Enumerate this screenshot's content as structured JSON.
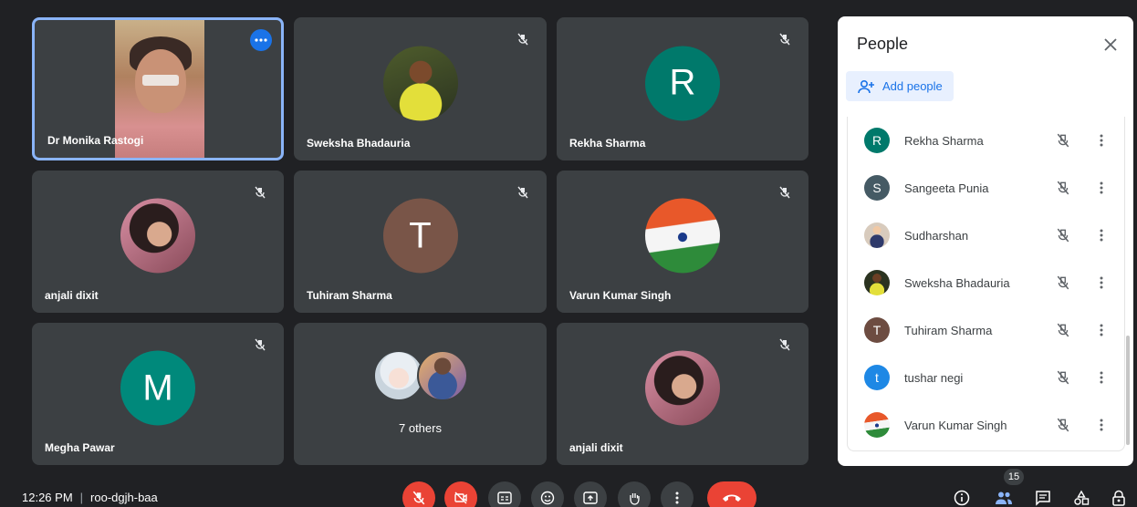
{
  "colors": {
    "tile_bg": "#3c4043",
    "page_bg": "#202124",
    "active_border": "#8ab4f8",
    "end_call": "#ea4335",
    "accent": "#1a73e8"
  },
  "tiles": [
    {
      "name": "Dr Monika Rastogi",
      "type": "video",
      "active": true
    },
    {
      "name": "Sweksha Bhadauria",
      "type": "photo"
    },
    {
      "name": "Rekha Sharma",
      "type": "letter",
      "letter": "R",
      "color": "#00796b"
    },
    {
      "name": "anjali dixit",
      "type": "photo"
    },
    {
      "name": "Tuhiram Sharma",
      "type": "letter",
      "letter": "T",
      "color": "#795548"
    },
    {
      "name": "Varun Kumar Singh",
      "type": "photo"
    },
    {
      "name": "Megha Pawar",
      "type": "letter",
      "letter": "M",
      "color": "#00897b"
    },
    {
      "name": "7 others",
      "type": "others"
    },
    {
      "name": "anjali dixit",
      "type": "photo"
    }
  ],
  "people_panel": {
    "title": "People",
    "add_label": "Add people",
    "participants": [
      {
        "name": "Rekha Sharma",
        "letter": "R",
        "color": "#00796b"
      },
      {
        "name": "Sangeeta Punia",
        "letter": "S",
        "color": "#455a64"
      },
      {
        "name": "Sudharshan",
        "letter": "",
        "color": "#5d4037"
      },
      {
        "name": "Sweksha Bhadauria",
        "letter": "",
        "color": "#33691e"
      },
      {
        "name": "Tuhiram Sharma",
        "letter": "T",
        "color": "#6d4c41"
      },
      {
        "name": "tushar negi",
        "letter": "t",
        "color": "#1e88e5"
      },
      {
        "name": "Varun Kumar Singh",
        "letter": "",
        "color": "#e65100"
      }
    ]
  },
  "bottom_bar": {
    "time": "12:26 PM",
    "meeting_code": "roo-dgjh-baa",
    "participant_count": "15"
  },
  "icons": {
    "tile_mute": "mic-off-icon",
    "more": "more-horiz-icon",
    "close": "close-icon",
    "add_person": "person-add-icon",
    "info": "info-icon",
    "people": "people-icon",
    "chat": "chat-icon",
    "activities": "activities-icon",
    "host_controls": "lock-person-icon"
  }
}
